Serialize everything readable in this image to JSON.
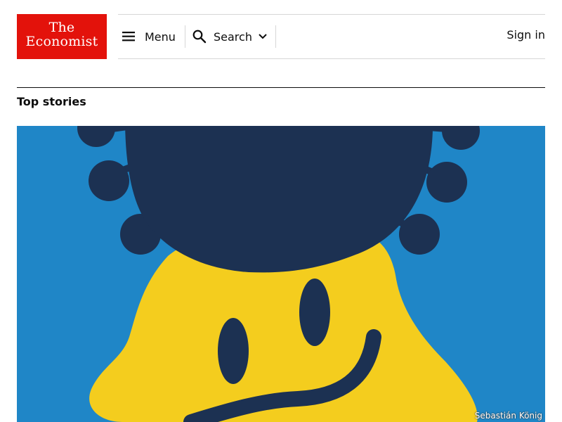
{
  "logo": {
    "line1": "The",
    "line2": "Economist"
  },
  "nav": {
    "menu_label": "Menu",
    "search_label": "Search",
    "signin_label": "Sign in"
  },
  "section": {
    "title": "Top stories"
  },
  "hero": {
    "credit": "Sebastián König"
  },
  "colors": {
    "brand_red": "#e3120b",
    "hero_blue": "#1f86c7",
    "virus_navy": "#1c3152",
    "face_yellow": "#f4cd1e"
  }
}
